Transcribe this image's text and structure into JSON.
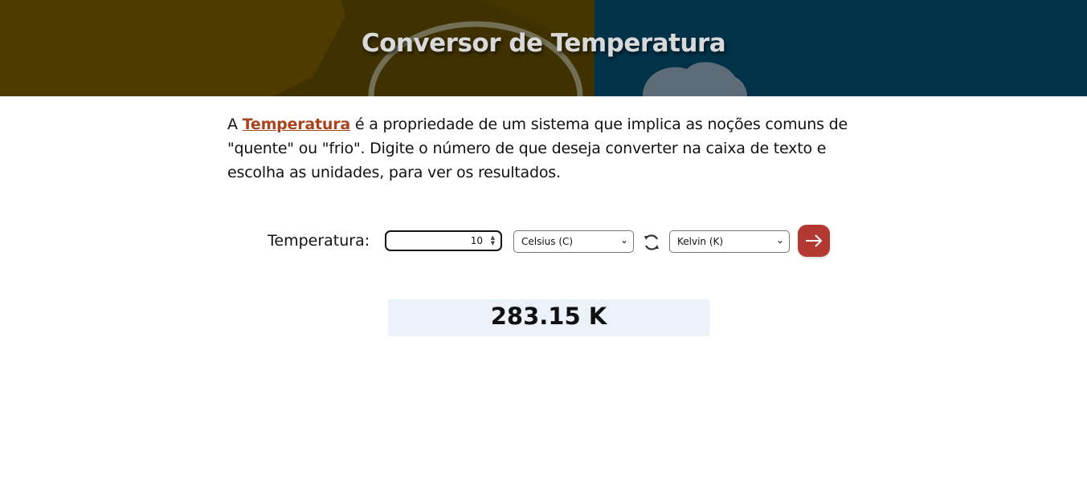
{
  "header": {
    "title": "Conversor de Temperatura"
  },
  "intro": {
    "prefix": "A ",
    "link": "Temperatura",
    "text": " é a propriedade de um sistema que implica as noções comuns de \"quente\" ou \"frio\". Digite o número de que deseja converter na caixa de texto e escolha as unidades, para ver os resultados."
  },
  "converter": {
    "label": "Temperatura:",
    "value": "10",
    "from_unit": "Celsius (C)",
    "to_unit": "Kelvin (K)",
    "swap_icon": "refresh-icon",
    "convert_icon": "arrow-right-icon"
  },
  "result": {
    "text": "283.15 K"
  },
  "colors": {
    "header_left": "#4a3a00",
    "header_right": "#00324a",
    "link": "#a9431c",
    "button": "#b23a33",
    "result_bg": "#edf1fb"
  }
}
